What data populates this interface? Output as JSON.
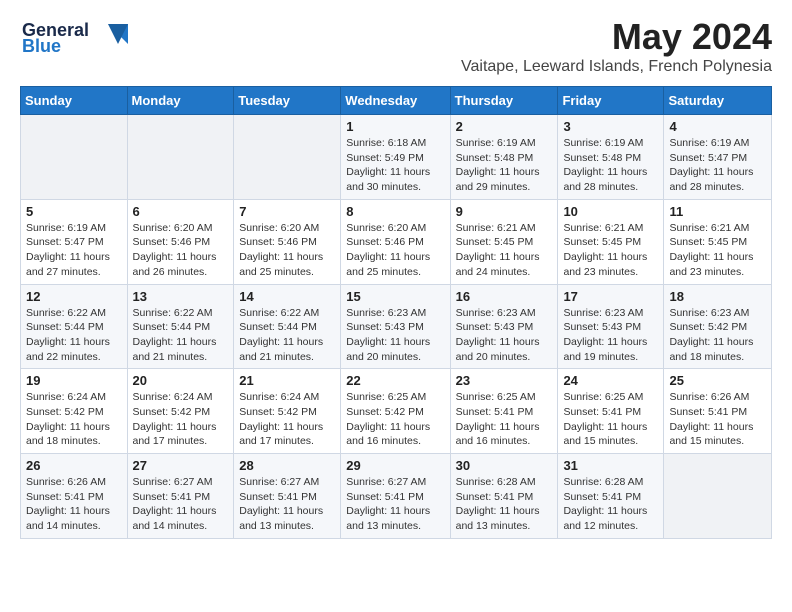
{
  "logo": {
    "line1": "General",
    "line2": "Blue"
  },
  "title": "May 2024",
  "location": "Vaitape, Leeward Islands, French Polynesia",
  "weekdays": [
    "Sunday",
    "Monday",
    "Tuesday",
    "Wednesday",
    "Thursday",
    "Friday",
    "Saturday"
  ],
  "weeks": [
    [
      {
        "day": "",
        "info": ""
      },
      {
        "day": "",
        "info": ""
      },
      {
        "day": "",
        "info": ""
      },
      {
        "day": "1",
        "info": "Sunrise: 6:18 AM\nSunset: 5:49 PM\nDaylight: 11 hours\nand 30 minutes."
      },
      {
        "day": "2",
        "info": "Sunrise: 6:19 AM\nSunset: 5:48 PM\nDaylight: 11 hours\nand 29 minutes."
      },
      {
        "day": "3",
        "info": "Sunrise: 6:19 AM\nSunset: 5:48 PM\nDaylight: 11 hours\nand 28 minutes."
      },
      {
        "day": "4",
        "info": "Sunrise: 6:19 AM\nSunset: 5:47 PM\nDaylight: 11 hours\nand 28 minutes."
      }
    ],
    [
      {
        "day": "5",
        "info": "Sunrise: 6:19 AM\nSunset: 5:47 PM\nDaylight: 11 hours\nand 27 minutes."
      },
      {
        "day": "6",
        "info": "Sunrise: 6:20 AM\nSunset: 5:46 PM\nDaylight: 11 hours\nand 26 minutes."
      },
      {
        "day": "7",
        "info": "Sunrise: 6:20 AM\nSunset: 5:46 PM\nDaylight: 11 hours\nand 25 minutes."
      },
      {
        "day": "8",
        "info": "Sunrise: 6:20 AM\nSunset: 5:46 PM\nDaylight: 11 hours\nand 25 minutes."
      },
      {
        "day": "9",
        "info": "Sunrise: 6:21 AM\nSunset: 5:45 PM\nDaylight: 11 hours\nand 24 minutes."
      },
      {
        "day": "10",
        "info": "Sunrise: 6:21 AM\nSunset: 5:45 PM\nDaylight: 11 hours\nand 23 minutes."
      },
      {
        "day": "11",
        "info": "Sunrise: 6:21 AM\nSunset: 5:45 PM\nDaylight: 11 hours\nand 23 minutes."
      }
    ],
    [
      {
        "day": "12",
        "info": "Sunrise: 6:22 AM\nSunset: 5:44 PM\nDaylight: 11 hours\nand 22 minutes."
      },
      {
        "day": "13",
        "info": "Sunrise: 6:22 AM\nSunset: 5:44 PM\nDaylight: 11 hours\nand 21 minutes."
      },
      {
        "day": "14",
        "info": "Sunrise: 6:22 AM\nSunset: 5:44 PM\nDaylight: 11 hours\nand 21 minutes."
      },
      {
        "day": "15",
        "info": "Sunrise: 6:23 AM\nSunset: 5:43 PM\nDaylight: 11 hours\nand 20 minutes."
      },
      {
        "day": "16",
        "info": "Sunrise: 6:23 AM\nSunset: 5:43 PM\nDaylight: 11 hours\nand 20 minutes."
      },
      {
        "day": "17",
        "info": "Sunrise: 6:23 AM\nSunset: 5:43 PM\nDaylight: 11 hours\nand 19 minutes."
      },
      {
        "day": "18",
        "info": "Sunrise: 6:23 AM\nSunset: 5:42 PM\nDaylight: 11 hours\nand 18 minutes."
      }
    ],
    [
      {
        "day": "19",
        "info": "Sunrise: 6:24 AM\nSunset: 5:42 PM\nDaylight: 11 hours\nand 18 minutes."
      },
      {
        "day": "20",
        "info": "Sunrise: 6:24 AM\nSunset: 5:42 PM\nDaylight: 11 hours\nand 17 minutes."
      },
      {
        "day": "21",
        "info": "Sunrise: 6:24 AM\nSunset: 5:42 PM\nDaylight: 11 hours\nand 17 minutes."
      },
      {
        "day": "22",
        "info": "Sunrise: 6:25 AM\nSunset: 5:42 PM\nDaylight: 11 hours\nand 16 minutes."
      },
      {
        "day": "23",
        "info": "Sunrise: 6:25 AM\nSunset: 5:41 PM\nDaylight: 11 hours\nand 16 minutes."
      },
      {
        "day": "24",
        "info": "Sunrise: 6:25 AM\nSunset: 5:41 PM\nDaylight: 11 hours\nand 15 minutes."
      },
      {
        "day": "25",
        "info": "Sunrise: 6:26 AM\nSunset: 5:41 PM\nDaylight: 11 hours\nand 15 minutes."
      }
    ],
    [
      {
        "day": "26",
        "info": "Sunrise: 6:26 AM\nSunset: 5:41 PM\nDaylight: 11 hours\nand 14 minutes."
      },
      {
        "day": "27",
        "info": "Sunrise: 6:27 AM\nSunset: 5:41 PM\nDaylight: 11 hours\nand 14 minutes."
      },
      {
        "day": "28",
        "info": "Sunrise: 6:27 AM\nSunset: 5:41 PM\nDaylight: 11 hours\nand 13 minutes."
      },
      {
        "day": "29",
        "info": "Sunrise: 6:27 AM\nSunset: 5:41 PM\nDaylight: 11 hours\nand 13 minutes."
      },
      {
        "day": "30",
        "info": "Sunrise: 6:28 AM\nSunset: 5:41 PM\nDaylight: 11 hours\nand 13 minutes."
      },
      {
        "day": "31",
        "info": "Sunrise: 6:28 AM\nSunset: 5:41 PM\nDaylight: 11 hours\nand 12 minutes."
      },
      {
        "day": "",
        "info": ""
      }
    ]
  ]
}
